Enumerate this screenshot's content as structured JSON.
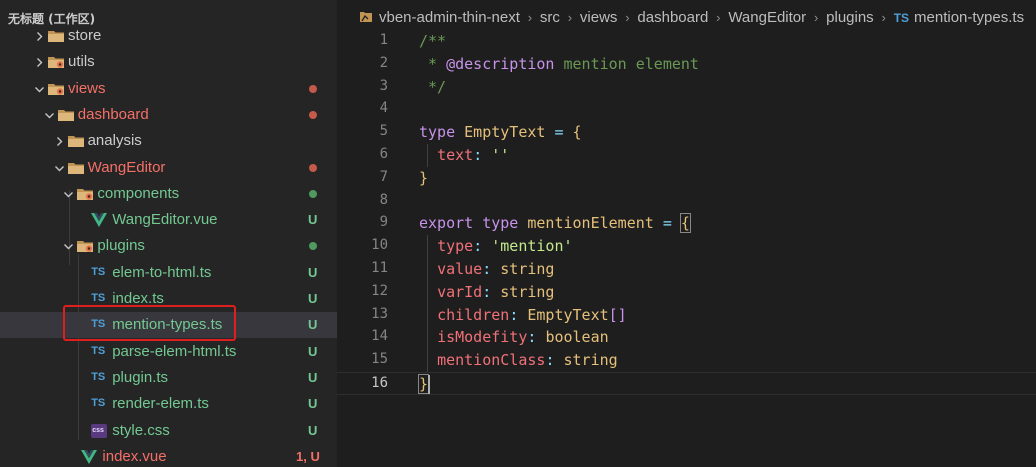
{
  "explorer": {
    "title": "无标题 (工作区)",
    "items": [
      {
        "label": "store",
        "kind": "folder",
        "expanded": false,
        "depth": 1,
        "color": "#cccccc"
      },
      {
        "label": "utils",
        "kind": "folder-special",
        "expanded": false,
        "depth": 1,
        "color": "#cccccc"
      },
      {
        "label": "views",
        "kind": "folder-special",
        "expanded": true,
        "depth": 1,
        "color": "#f47067"
      },
      {
        "label": "dashboard",
        "kind": "folder",
        "expanded": true,
        "depth": 2,
        "color": "#f47067"
      },
      {
        "label": "analysis",
        "kind": "folder",
        "expanded": false,
        "depth": 3,
        "color": "#cccccc"
      },
      {
        "label": "WangEditor",
        "kind": "folder",
        "expanded": true,
        "depth": 3,
        "color": "#f47067"
      },
      {
        "label": "components",
        "kind": "folder-special",
        "expanded": true,
        "depth": 4,
        "color": "#73c991"
      },
      {
        "label": "WangEditor.vue",
        "kind": "vue",
        "depth": 5,
        "color": "#73c991",
        "badge": "U"
      },
      {
        "label": "plugins",
        "kind": "folder-special",
        "expanded": true,
        "depth": 4,
        "color": "#73c991"
      },
      {
        "label": "elem-to-html.ts",
        "kind": "ts",
        "depth": 5,
        "color": "#73c991",
        "badge": "U"
      },
      {
        "label": "index.ts",
        "kind": "ts",
        "depth": 5,
        "color": "#73c991",
        "badge": "U"
      },
      {
        "label": "mention-types.ts",
        "kind": "ts",
        "depth": 5,
        "color": "#73c991",
        "badge": "U",
        "selected": true
      },
      {
        "label": "parse-elem-html.ts",
        "kind": "ts",
        "depth": 5,
        "color": "#73c991",
        "badge": "U"
      },
      {
        "label": "plugin.ts",
        "kind": "ts",
        "depth": 5,
        "color": "#73c991",
        "badge": "U"
      },
      {
        "label": "render-elem.ts",
        "kind": "ts",
        "depth": 5,
        "color": "#73c991",
        "badge": "U"
      },
      {
        "label": "style.css",
        "kind": "css",
        "depth": 5,
        "color": "#73c991",
        "badge": "U"
      },
      {
        "label": "index.vue",
        "kind": "vue",
        "depth": 4,
        "color": "#f47067",
        "badge": "1, U"
      }
    ],
    "icons": {
      "ts": "TS",
      "css": "css"
    }
  },
  "breadcrumb": {
    "items": [
      "vben-admin-thin-next",
      "src",
      "views",
      "dashboard",
      "WangEditor",
      "plugins",
      "mention-types.ts"
    ],
    "file_icon": "TS"
  },
  "editor": {
    "current_line": 16,
    "lines": [
      {
        "n": "1",
        "tokens": [
          {
            "t": "/**",
            "c": "comment"
          }
        ]
      },
      {
        "n": "2",
        "tokens": [
          {
            "t": " * ",
            "c": "comment"
          },
          {
            "t": "@description",
            "c": "tag"
          },
          {
            "t": " mention element",
            "c": "comment"
          }
        ]
      },
      {
        "n": "3",
        "tokens": [
          {
            "t": " */",
            "c": "comment"
          }
        ]
      },
      {
        "n": "4",
        "tokens": []
      },
      {
        "n": "5",
        "tokens": [
          {
            "t": "type",
            "c": "keyword"
          },
          {
            "t": " ",
            "c": "plain"
          },
          {
            "t": "EmptyText",
            "c": "type"
          },
          {
            "t": " = ",
            "c": "punct"
          },
          {
            "t": "{",
            "c": "brace"
          }
        ]
      },
      {
        "n": "6",
        "tokens": [
          {
            "t": "  ",
            "c": "plain"
          },
          {
            "t": "text",
            "c": "prop"
          },
          {
            "t": ": ",
            "c": "punct"
          },
          {
            "t": "''",
            "c": "string"
          }
        ]
      },
      {
        "n": "7",
        "tokens": [
          {
            "t": "}",
            "c": "brace"
          }
        ]
      },
      {
        "n": "8",
        "tokens": []
      },
      {
        "n": "9",
        "tokens": [
          {
            "t": "export",
            "c": "keyword"
          },
          {
            "t": " ",
            "c": "plain"
          },
          {
            "t": "type",
            "c": "keyword"
          },
          {
            "t": " ",
            "c": "plain"
          },
          {
            "t": "mentionElement",
            "c": "type"
          },
          {
            "t": " = ",
            "c": "punct"
          },
          {
            "t": "{",
            "c": "bracehl"
          }
        ]
      },
      {
        "n": "10",
        "tokens": [
          {
            "t": "  ",
            "c": "plain"
          },
          {
            "t": "type",
            "c": "prop"
          },
          {
            "t": ": ",
            "c": "punct"
          },
          {
            "t": "'mention'",
            "c": "string"
          }
        ]
      },
      {
        "n": "11",
        "tokens": [
          {
            "t": "  ",
            "c": "plain"
          },
          {
            "t": "value",
            "c": "prop"
          },
          {
            "t": ": ",
            "c": "punct"
          },
          {
            "t": "string",
            "c": "type"
          }
        ]
      },
      {
        "n": "12",
        "tokens": [
          {
            "t": "  ",
            "c": "plain"
          },
          {
            "t": "varId",
            "c": "prop"
          },
          {
            "t": ": ",
            "c": "punct"
          },
          {
            "t": "string",
            "c": "type"
          }
        ]
      },
      {
        "n": "13",
        "tokens": [
          {
            "t": "  ",
            "c": "plain"
          },
          {
            "t": "children",
            "c": "prop"
          },
          {
            "t": ": ",
            "c": "punct"
          },
          {
            "t": "EmptyText",
            "c": "type"
          },
          {
            "t": "[]",
            "c": "tag"
          }
        ]
      },
      {
        "n": "14",
        "tokens": [
          {
            "t": "  ",
            "c": "plain"
          },
          {
            "t": "isModefity",
            "c": "prop"
          },
          {
            "t": ": ",
            "c": "punct"
          },
          {
            "t": "boolean",
            "c": "type"
          }
        ]
      },
      {
        "n": "15",
        "tokens": [
          {
            "t": "  ",
            "c": "plain"
          },
          {
            "t": "mentionClass",
            "c": "prop"
          },
          {
            "t": ": ",
            "c": "punct"
          },
          {
            "t": "string",
            "c": "type"
          }
        ]
      },
      {
        "n": "16",
        "tokens": [
          {
            "t": "}",
            "c": "bracehl"
          }
        ]
      }
    ]
  },
  "colors": {
    "sidebar_bg": "#252526",
    "editor_bg": "#1e1e1e",
    "selection_bg": "#37373d",
    "untracked": "#73c991",
    "modified": "#f47067",
    "highlight_box": "#e01e1e",
    "modified_dot": "#c55a4a",
    "untracked_dot": "#4f9a5e"
  }
}
